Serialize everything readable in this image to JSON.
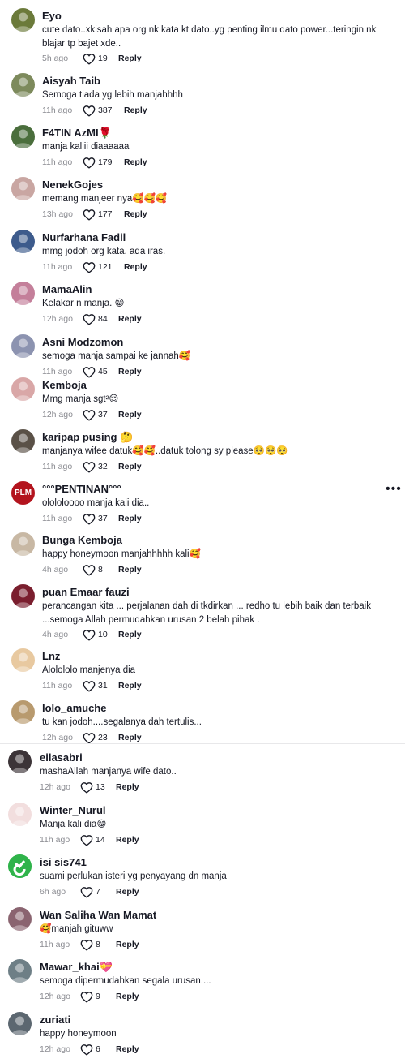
{
  "comments": [
    {
      "user": "Eyo",
      "text": "cute dato..xkisah apa org nk kata kt dato..yg penting ilmu dato power...teringin nk blajar tp bajet xde..",
      "time": "5h ago",
      "likes": "19",
      "reply": "Reply",
      "avatar_color": "#6b7a3a"
    },
    {
      "user": "Aisyah Taib",
      "text": "Semoga tiada yg lebih manjahhhh",
      "time": "11h ago",
      "likes": "387",
      "reply": "Reply",
      "avatar_color": "#7d8a5c"
    },
    {
      "user": "F4TIN AzMI🌹",
      "text": "manja kaliii diaaaaaa",
      "time": "11h ago",
      "likes": "179",
      "reply": "Reply",
      "avatar_color": "#4a6e3c"
    },
    {
      "user": "NenekGojes",
      "text": "memang manjeer nya🥰🥰🥰",
      "time": "13h ago",
      "likes": "177",
      "reply": "Reply",
      "avatar_color": "#c9a6a2"
    },
    {
      "user": "Nurfarhana Fadil",
      "text": "mmg jodoh org kata. ada iras.",
      "time": "11h ago",
      "likes": "121",
      "reply": "Reply",
      "avatar_color": "#3d5b8c"
    },
    {
      "user": "MamaAlin",
      "text": "Kelakar n manja. 😁",
      "time": "12h ago",
      "likes": "84",
      "reply": "Reply",
      "avatar_color": "#c47f9a"
    },
    {
      "user": "Asni Modzomon",
      "text": "semoga manja sampai ke jannah🥰",
      "time": "11h ago",
      "likes": "45",
      "reply": "Reply",
      "avatar_color": "#8c93b0"
    },
    {
      "user": "Kemboja",
      "text": "Mmg manja sgt²😌",
      "time": "12h ago",
      "likes": "37",
      "reply": "Reply",
      "avatar_color": "#d9a7a7"
    },
    {
      "user": "karipap pusing 🤔",
      "text": "manjanya wifee datuk🥰🥰..datuk tolong sy please🥺🥺🥺",
      "time": "11h ago",
      "likes": "32",
      "reply": "Reply",
      "avatar_color": "#5a5147"
    },
    {
      "user": "°°°PENTINAN°°°",
      "text": "olololoooo manja kali dia..",
      "time": "11h ago",
      "likes": "37",
      "reply": "Reply",
      "avatar_color": "#b3141e",
      "logo": "PLM"
    },
    {
      "user": "Bunga Kemboja",
      "text": "happy honeymoon manjahhhhh kali🥰",
      "time": "4h ago",
      "likes": "8",
      "reply": "Reply",
      "avatar_color": "#c8b8a4"
    },
    {
      "user": "puan Emaar fauzi",
      "text": "perancangan kita ... perjalanan dah di tkdirkan ... redho tu lebih baik dan terbaik ...semoga Allah permudahkan urusan 2 belah pihak .",
      "time": "4h ago",
      "likes": "10",
      "reply": "Reply",
      "avatar_color": "#7a1e2e"
    },
    {
      "user": "Lnz",
      "text": "Alolololo manjenya dia",
      "time": "11h ago",
      "likes": "31",
      "reply": "Reply",
      "avatar_color": "#e8c9a0"
    },
    {
      "user": "lolo_amuche",
      "text": "tu kan jodoh....segalanya dah tertulis...",
      "time": "12h ago",
      "likes": "23",
      "reply": "Reply",
      "avatar_color": "#b89a6e"
    },
    {
      "user": "eilasabri",
      "text": "mashaAllah manjanya wife dato..",
      "time": "12h ago",
      "likes": "13",
      "reply": "Reply",
      "avatar_color": "#3c3438"
    },
    {
      "user": "Winter_Nurul",
      "text": "Manja kali dia😁",
      "time": "11h ago",
      "likes": "14",
      "reply": "Reply",
      "avatar_color": "#f2dede"
    },
    {
      "user": "isi sis741",
      "text": "suami perlukan isteri yg penyayang dn manja",
      "time": "6h ago",
      "likes": "7",
      "reply": "Reply",
      "avatar_color": "#2fb34a"
    },
    {
      "user": "Wan Saliha Wan Mamat",
      "text": "🥰manjah gituww",
      "time": "11h ago",
      "likes": "8",
      "reply": "Reply",
      "avatar_color": "#8a6470"
    },
    {
      "user": "Mawar_khai💝",
      "text": "semoga dipermudahkan segala urusan....",
      "time": "12h ago",
      "likes": "9",
      "reply": "Reply",
      "avatar_color": "#6e7f86"
    },
    {
      "user": "zuriati",
      "text": "happy honeymoon",
      "time": "12h ago",
      "likes": "6",
      "reply": "Reply",
      "avatar_color": "#5c6770"
    }
  ],
  "icons": {
    "like": "heart-outline-icon",
    "more": "more-horizontal-icon"
  }
}
